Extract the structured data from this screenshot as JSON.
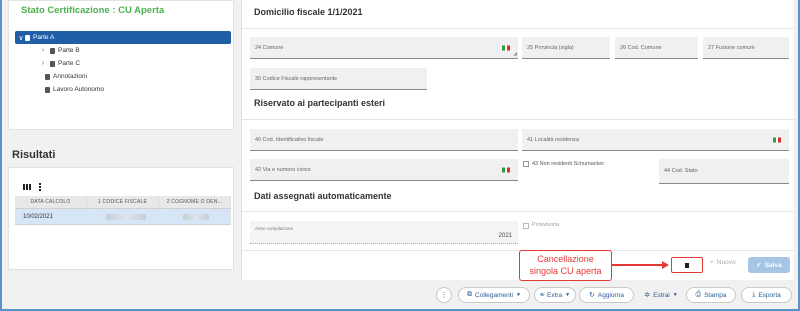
{
  "left": {
    "cert_title": "Stato Certificazione : CU Aperta",
    "tree": [
      {
        "label": "Parte A",
        "chev": "∨",
        "selected": true
      },
      {
        "label": "Parte B",
        "chev": "›",
        "selected": false
      },
      {
        "label": "Parte C",
        "chev": "›",
        "selected": false
      },
      {
        "label": "Annotazioni",
        "chev": "",
        "selected": false
      },
      {
        "label": "Lavoro Autonomo",
        "chev": "",
        "selected": false
      }
    ],
    "risultati_title": "Risultati",
    "table": {
      "headers": [
        "DATA CALCOLO",
        "1 CODICE FISCALE",
        "2 COGNOME O DEN..."
      ],
      "rows": [
        [
          "10/02/2021",
          "",
          ""
        ]
      ]
    }
  },
  "right": {
    "sec1": "Domicilio fiscale 1/1/2021",
    "f24": "24 Comune",
    "f25": "25 Provincia (sigla)",
    "f26": "26 Cod. Comune",
    "f27": "27 Fusione comuni",
    "f30": "30 Codice Fiscale rappresentante",
    "sec2": "Riservato ai partecipanti esteri",
    "f40": "40 Cod. Identificativo fiscale",
    "f41": "41 Località residenza",
    "f42": "42 Via e numero civico",
    "f43": "43 Non residenti Schumacker",
    "f44": "44 Cod. Stato",
    "sec3": "Dati assegnati automaticamente",
    "anno_label": "Anno compilazione",
    "anno_value": "2021",
    "provvisoria": "Provvisoria"
  },
  "actions": {
    "nuovo": "Nuovo",
    "salva": "Salva"
  },
  "callout": {
    "line1": "Cancellazione",
    "line2": "singola CU aperta"
  },
  "toolbar": {
    "collegamenti": "Collegamenti",
    "extra": "Extra",
    "aggiorna": "Aggiorna",
    "estrai": "Estrai",
    "stampa": "Stampa",
    "esporta": "Esporta"
  },
  "colors": {
    "accent": "#1f5fa8",
    "title_green": "#4caf50",
    "callout_red": "#e53935",
    "frame_blue": "#5b93c9"
  }
}
